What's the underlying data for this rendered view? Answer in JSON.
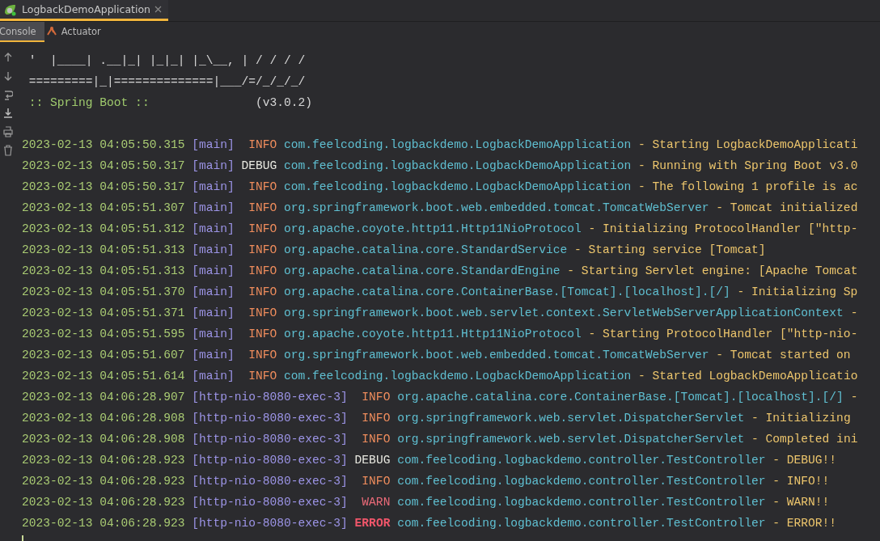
{
  "run_tab": {
    "title": "LogbackDemoApplication",
    "selected": true
  },
  "tool_tabs": [
    {
      "label": "Console",
      "selected": true
    },
    {
      "label": "Actuator",
      "selected": false
    }
  ],
  "banner": [
    " '  |____| .__|_| |_|_| |_\\__, | / / / /",
    " =========|_|==============|___/=/_/_/_/"
  ],
  "spring_boot_line": {
    "label": " :: Spring Boot ::",
    "version": "(v3.0.2)"
  },
  "log_lines": [
    {
      "timestamp": "2023-02-13 04:05:50.315",
      "thread": "[main]",
      "level": "INFO",
      "logger": "com.feelcoding.logbackdemo.LogbackDemoApplication",
      "message": "- Starting LogbackDemoApplicati"
    },
    {
      "timestamp": "2023-02-13 04:05:50.317",
      "thread": "[main]",
      "level": "DEBUG",
      "logger": "com.feelcoding.logbackdemo.LogbackDemoApplication",
      "message": "- Running with Spring Boot v3.0"
    },
    {
      "timestamp": "2023-02-13 04:05:50.317",
      "thread": "[main]",
      "level": "INFO",
      "logger": "com.feelcoding.logbackdemo.LogbackDemoApplication",
      "message": "- The following 1 profile is ac"
    },
    {
      "timestamp": "2023-02-13 04:05:51.307",
      "thread": "[main]",
      "level": "INFO",
      "logger": "org.springframework.boot.web.embedded.tomcat.TomcatWebServer",
      "message": "- Tomcat initialized"
    },
    {
      "timestamp": "2023-02-13 04:05:51.312",
      "thread": "[main]",
      "level": "INFO",
      "logger": "org.apache.coyote.http11.Http11NioProtocol",
      "message": "- Initializing ProtocolHandler [\"http-"
    },
    {
      "timestamp": "2023-02-13 04:05:51.313",
      "thread": "[main]",
      "level": "INFO",
      "logger": "org.apache.catalina.core.StandardService",
      "message": "- Starting service [Tomcat]"
    },
    {
      "timestamp": "2023-02-13 04:05:51.313",
      "thread": "[main]",
      "level": "INFO",
      "logger": "org.apache.catalina.core.StandardEngine",
      "message": "- Starting Servlet engine: [Apache Tomcat"
    },
    {
      "timestamp": "2023-02-13 04:05:51.370",
      "thread": "[main]",
      "level": "INFO",
      "logger": "org.apache.catalina.core.ContainerBase.[Tomcat].[localhost].[/]",
      "message": "- Initializing Sp"
    },
    {
      "timestamp": "2023-02-13 04:05:51.371",
      "thread": "[main]",
      "level": "INFO",
      "logger": "org.springframework.boot.web.servlet.context.ServletWebServerApplicationContext",
      "message": "-"
    },
    {
      "timestamp": "2023-02-13 04:05:51.595",
      "thread": "[main]",
      "level": "INFO",
      "logger": "org.apache.coyote.http11.Http11NioProtocol",
      "message": "- Starting ProtocolHandler [\"http-nio-"
    },
    {
      "timestamp": "2023-02-13 04:05:51.607",
      "thread": "[main]",
      "level": "INFO",
      "logger": "org.springframework.boot.web.embedded.tomcat.TomcatWebServer",
      "message": "- Tomcat started on"
    },
    {
      "timestamp": "2023-02-13 04:05:51.614",
      "thread": "[main]",
      "level": "INFO",
      "logger": "com.feelcoding.logbackdemo.LogbackDemoApplication",
      "message": "- Started LogbackDemoApplicatio"
    },
    {
      "timestamp": "2023-02-13 04:06:28.907",
      "thread": "[http-nio-8080-exec-3]",
      "level": "INFO",
      "logger": "org.apache.catalina.core.ContainerBase.[Tomcat].[localhost].[/]",
      "message": "-"
    },
    {
      "timestamp": "2023-02-13 04:06:28.908",
      "thread": "[http-nio-8080-exec-3]",
      "level": "INFO",
      "logger": "org.springframework.web.servlet.DispatcherServlet",
      "message": "- Initializing"
    },
    {
      "timestamp": "2023-02-13 04:06:28.908",
      "thread": "[http-nio-8080-exec-3]",
      "level": "INFO",
      "logger": "org.springframework.web.servlet.DispatcherServlet",
      "message": "- Completed ini"
    },
    {
      "timestamp": "2023-02-13 04:06:28.923",
      "thread": "[http-nio-8080-exec-3]",
      "level": "DEBUG",
      "logger": "com.feelcoding.logbackdemo.controller.TestController",
      "message": "- DEBUG!!"
    },
    {
      "timestamp": "2023-02-13 04:06:28.923",
      "thread": "[http-nio-8080-exec-3]",
      "level": "INFO",
      "logger": "com.feelcoding.logbackdemo.controller.TestController",
      "message": "- INFO!!"
    },
    {
      "timestamp": "2023-02-13 04:06:28.923",
      "thread": "[http-nio-8080-exec-3]",
      "level": "WARN",
      "logger": "com.feelcoding.logbackdemo.controller.TestController",
      "message": "- WARN!!"
    },
    {
      "timestamp": "2023-02-13 04:06:28.923",
      "thread": "[http-nio-8080-exec-3]",
      "level": "ERROR",
      "logger": "com.feelcoding.logbackdemo.controller.TestController",
      "message": "- ERROR!!"
    }
  ]
}
